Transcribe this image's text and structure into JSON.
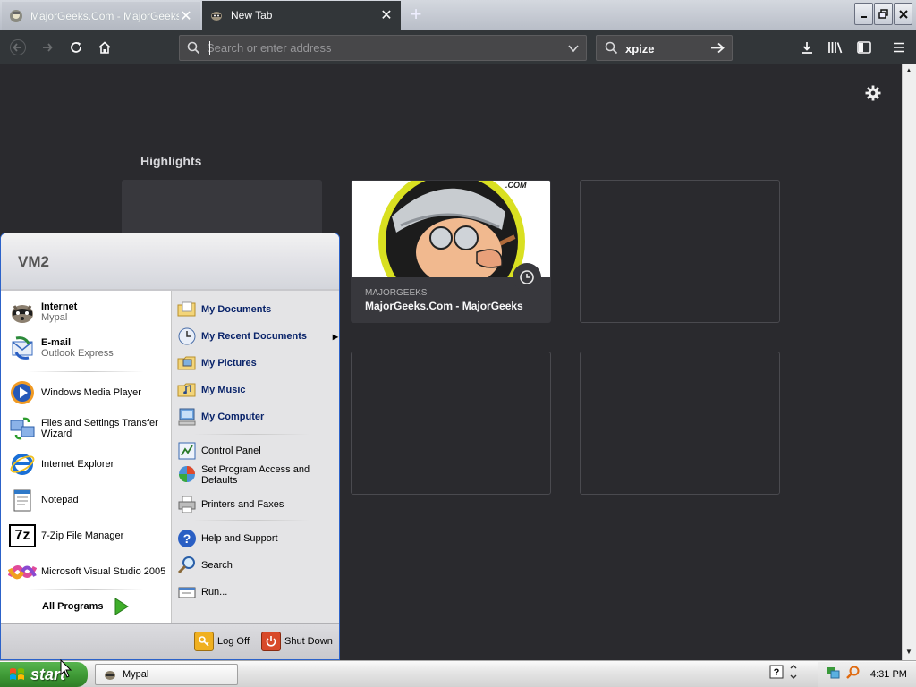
{
  "browser": {
    "tabs": [
      {
        "title": "MajorGeeks.Com - MajorGeeks",
        "active": false
      },
      {
        "title": "New Tab",
        "active": true
      }
    ],
    "address_bar": {
      "placeholder": "Search or enter address",
      "value": ""
    },
    "search_bar": {
      "value": "xpize"
    }
  },
  "newtab": {
    "highlights_heading": "Highlights",
    "cards": [
      {
        "host": "MAJORGEEKS",
        "title": "MajorGeeks.Com - MajorGeeks",
        "image_text": ".COM"
      }
    ]
  },
  "start_menu": {
    "user": "VM2",
    "pinned": [
      {
        "label": "Internet",
        "sub": "Mypal",
        "icon": "mypal-raccoon-icon"
      },
      {
        "label": "E-mail",
        "sub": "Outlook Express",
        "icon": "outlook-express-icon"
      }
    ],
    "recent": [
      {
        "label": "Windows Media Player",
        "icon": "media-player-icon"
      },
      {
        "label": "Files and Settings Transfer Wizard",
        "icon": "transfer-wizard-icon"
      },
      {
        "label": "Internet Explorer",
        "icon": "internet-explorer-icon"
      },
      {
        "label": "Notepad",
        "icon": "notepad-icon"
      },
      {
        "label": "7-Zip File Manager",
        "icon": "seven-zip-icon",
        "icon_text": "7z"
      },
      {
        "label": "Microsoft Visual Studio 2005",
        "icon": "visual-studio-icon"
      }
    ],
    "all_programs": "All Programs",
    "right": [
      {
        "label": "My Documents"
      },
      {
        "label": "My Recent Documents"
      },
      {
        "label": "My Pictures"
      },
      {
        "label": "My Music"
      },
      {
        "label": "My Computer"
      },
      {
        "label": "Control Panel"
      },
      {
        "label": "Set Program Access and Defaults"
      },
      {
        "label": "Printers and Faxes"
      },
      {
        "label": "Help and Support"
      },
      {
        "label": "Search"
      },
      {
        "label": "Run..."
      }
    ],
    "log_off": "Log Off",
    "shut_down": "Shut Down"
  },
  "taskbar": {
    "start_label": "start",
    "tasks": [
      {
        "label": "Mypal"
      }
    ],
    "clock": "4:31 PM"
  },
  "colors": {
    "browser_bg": "#2a2a2e",
    "toolbar": "#323639",
    "start_green": "#3c9633",
    "xp_link_blue": "#0a246a"
  }
}
